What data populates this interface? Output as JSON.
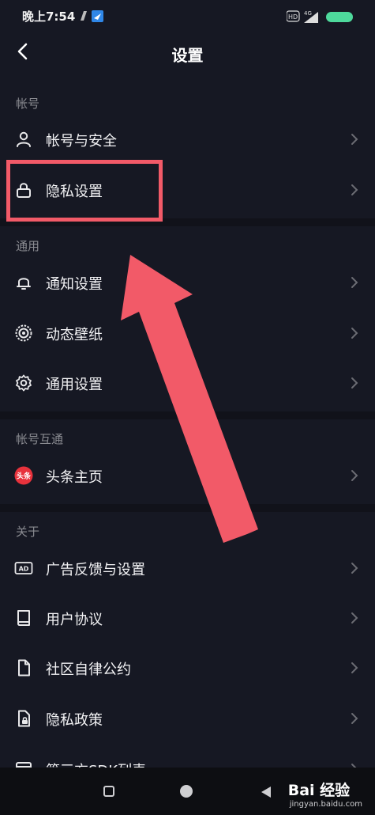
{
  "status_bar": {
    "time": "晚上7:54",
    "network": "4G",
    "hd": "HD"
  },
  "header": {
    "title": "设置"
  },
  "sections": [
    {
      "title": "帐号",
      "items": [
        {
          "label": "帐号与安全",
          "icon": "person-icon"
        },
        {
          "label": "隐私设置",
          "icon": "lock-icon"
        }
      ]
    },
    {
      "title": "通用",
      "items": [
        {
          "label": "通知设置",
          "icon": "bell-icon"
        },
        {
          "label": "动态壁纸",
          "icon": "wallpaper-icon"
        },
        {
          "label": "通用设置",
          "icon": "gear-icon"
        }
      ]
    },
    {
      "title": "帐号互通",
      "items": [
        {
          "label": "头条主页",
          "icon": "toutiao-logo-icon",
          "badge": "头条"
        }
      ]
    },
    {
      "title": "关于",
      "items": [
        {
          "label": "广告反馈与设置",
          "icon": "ad-icon",
          "badge": "AD"
        },
        {
          "label": "用户协议",
          "icon": "book-icon"
        },
        {
          "label": "社区自律公约",
          "icon": "document-icon"
        },
        {
          "label": "隐私政策",
          "icon": "privacy-document-icon"
        },
        {
          "label": "第三方SDK列表",
          "icon": "list-icon"
        }
      ]
    }
  ],
  "watermark": {
    "main": "Bai 经验",
    "sub": "jingyan.baidu.com"
  },
  "colors": {
    "background": "#161823",
    "highlight": "#f25a68",
    "text": "#f2f2f4",
    "section": "#8a8b91"
  }
}
